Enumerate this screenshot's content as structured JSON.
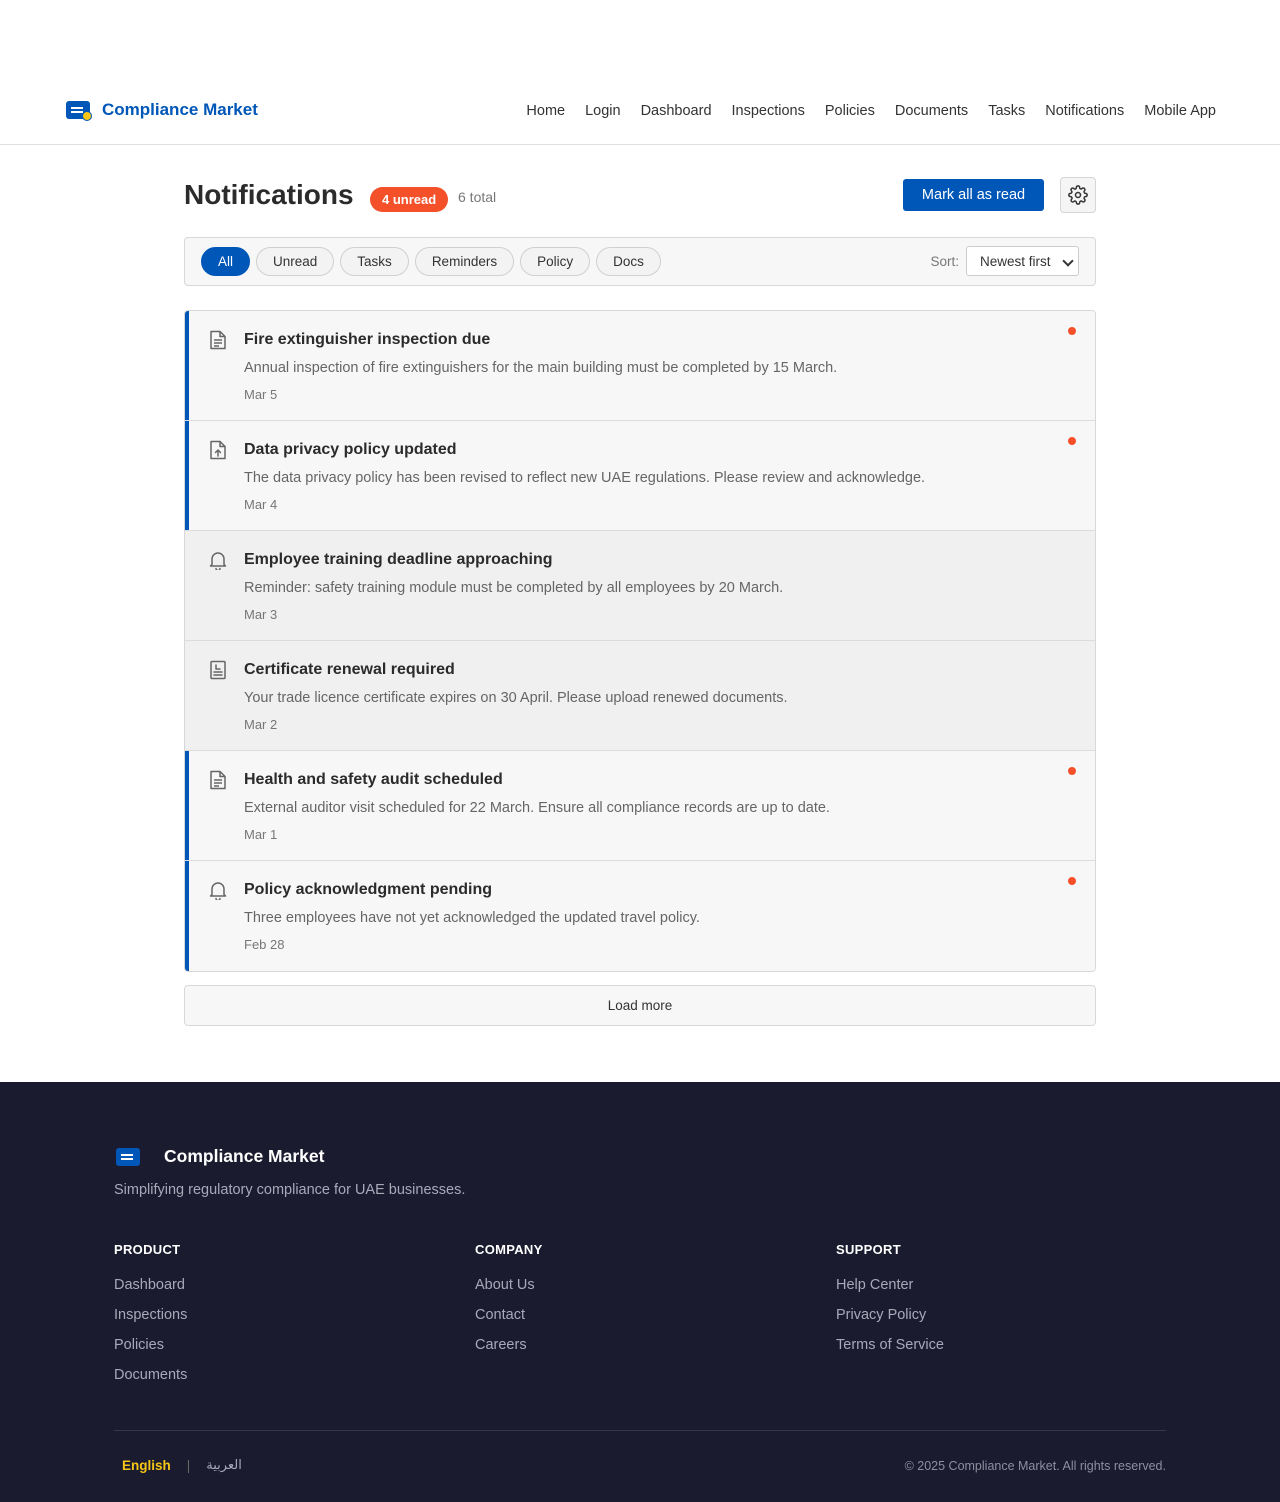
{
  "header": {
    "brand": "Compliance Market",
    "nav": [
      "Home",
      "Login",
      "Dashboard",
      "Inspections",
      "Policies",
      "Documents",
      "Tasks",
      "Notifications",
      "Mobile App"
    ]
  },
  "page": {
    "title": "Notifications",
    "unread_badge": "4 unread",
    "total": "6 total",
    "mark_all_label": "Mark all as read"
  },
  "filters": {
    "chips": [
      "All",
      "Unread",
      "Tasks",
      "Reminders",
      "Policy",
      "Docs"
    ],
    "active": "All",
    "sort_label": "Sort:",
    "sort_value": "Newest first"
  },
  "notifications": [
    {
      "title": "Fire extinguisher inspection due",
      "desc": "Annual inspection of fire extinguishers for the main building must be completed by 15 March.",
      "date": "Mar 5",
      "icon": "document-icon",
      "unread": true
    },
    {
      "title": "Data privacy policy updated",
      "desc": "The data privacy policy has been revised to reflect new UAE regulations. Please review and acknowledge.",
      "date": "Mar 4",
      "icon": "file-upload-icon",
      "unread": true
    },
    {
      "title": "Employee training deadline approaching",
      "desc": "Reminder: safety training module must be completed by all employees by 20 March.",
      "date": "Mar 3",
      "icon": "bell-icon",
      "unread": false
    },
    {
      "title": "Certificate renewal required",
      "desc": "Your trade licence certificate expires on 30 April. Please upload renewed documents.",
      "date": "Mar 2",
      "icon": "certificate-icon",
      "unread": false
    },
    {
      "title": "Health and safety audit scheduled",
      "desc": "External auditor visit scheduled for 22 March. Ensure all compliance records are up to date.",
      "date": "Mar 1",
      "icon": "document-icon",
      "unread": true
    },
    {
      "title": "Policy acknowledgment pending",
      "desc": "Three employees have not yet acknowledged the updated travel policy.",
      "date": "Feb 28",
      "icon": "bell-icon",
      "unread": true
    }
  ],
  "load_more_label": "Load more",
  "footer": {
    "brand": "Compliance Market",
    "tagline": "Simplifying regulatory compliance for UAE businesses.",
    "columns": [
      {
        "heading": "PRODUCT",
        "links": [
          "Dashboard",
          "Inspections",
          "Policies",
          "Documents"
        ]
      },
      {
        "heading": "COMPANY",
        "links": [
          "About Us",
          "Contact",
          "Careers"
        ]
      },
      {
        "heading": "SUPPORT",
        "links": [
          "Help Center",
          "Privacy Policy",
          "Terms of Service"
        ]
      }
    ],
    "lang_en": "English",
    "lang_sep": "|",
    "lang_ar": "العربية",
    "copyright": "© 2025 Compliance Market. All rights reserved."
  },
  "colors": {
    "primary": "#0057b8",
    "accent": "#f4502a",
    "footer_bg": "#1a1b2e",
    "lang_active": "#f5c518"
  }
}
